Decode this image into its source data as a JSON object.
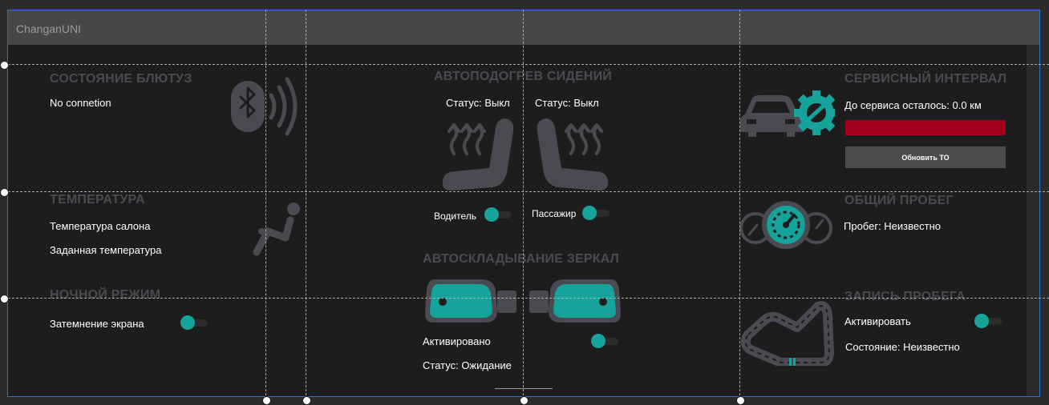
{
  "window": {
    "title": "ChanganUNI"
  },
  "colors": {
    "accent": "#15a39b",
    "danger": "#a0001c",
    "section_title": "#4a4a52",
    "panel": "#1d1d1d"
  },
  "bluetooth": {
    "title": "СОСТОЯНИЕ БЛЮТУЗ",
    "status": "No connetion",
    "icon": "bluetooth-icon"
  },
  "temperature": {
    "title": "ТЕМПЕРАТУРА",
    "cabin_label": "Температура салона",
    "target_label": "Заданная температура",
    "icon": "seat-person-icon"
  },
  "night_mode": {
    "title": "НОЧНОЙ РЕЖИМ",
    "dim_label": "Затемнение экрана",
    "dim_on": true
  },
  "seat_heating": {
    "title": "АВТОПОДОГРЕВ СИДЕНИЙ",
    "driver_status": "Статус: Выкл",
    "passenger_status": "Статус: Выкл",
    "driver_label": "Водитель",
    "passenger_label": "Пассажир",
    "driver_on": true,
    "passenger_on": true
  },
  "mirrors": {
    "title": "АВТОСКЛАДЫВАНИЕ ЗЕРКАЛ",
    "activated_label": "Активировано",
    "status": "Статус: Ожидание",
    "activated_on": true
  },
  "service": {
    "title": "СЕРВИСНЫЙ ИНТЕРВАЛ",
    "remaining": "До сервиса осталось: 0.0 км",
    "progress_fraction": 0,
    "update_label": "Обновить ТО",
    "icon": "car-gear-icon"
  },
  "mileage": {
    "title": "ОБЩИЙ ПРОБЕГ",
    "value": "Пробег: Неизвестно",
    "icon": "gauges-icon"
  },
  "trip_record": {
    "title": "ЗАПИСЬ ПРОБЕГА",
    "activate_label": "Активировать",
    "status": "Состояние: Неизвестно",
    "activate_on": true,
    "icon": "race-track-icon"
  }
}
